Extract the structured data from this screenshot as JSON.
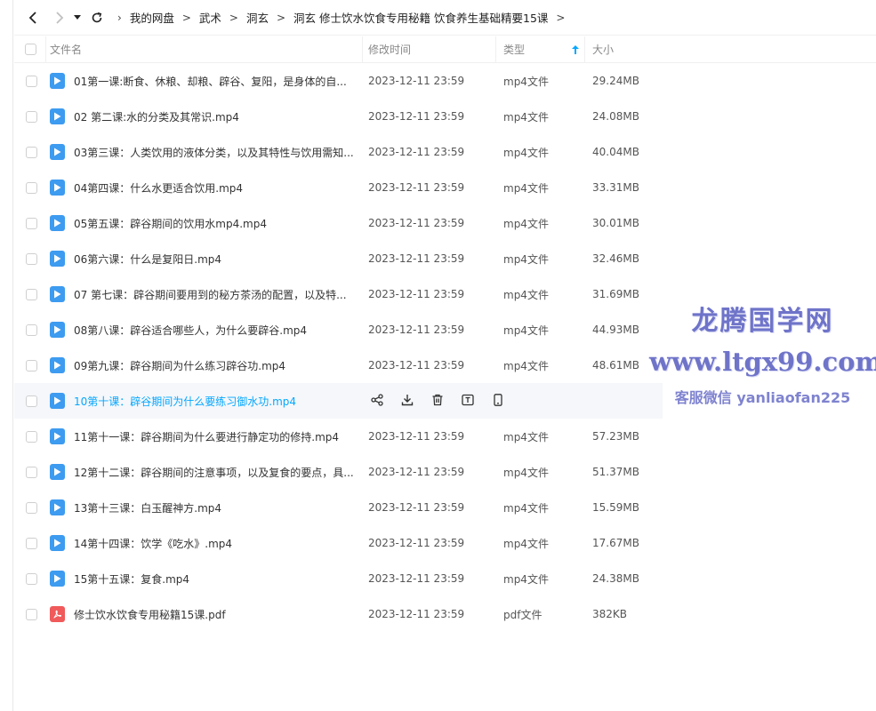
{
  "toolbar": {
    "breadcrumbs": [
      "我的网盘",
      "武术",
      "洞玄",
      "洞玄 修士饮水饮食专用秘籍 饮食养生基础精要15课"
    ]
  },
  "columns": {
    "name": "文件名",
    "time": "修改时间",
    "type": "类型",
    "size": "大小"
  },
  "files": [
    {
      "name": "01第一课:断食、休粮、却粮、辟谷、复阳，是身体的自...",
      "time": "2023-12-11 23:59",
      "type": "mp4文件",
      "size": "29.24MB",
      "kind": "mp4"
    },
    {
      "name": "02 第二课:水的分类及其常识.mp4",
      "time": "2023-12-11 23:59",
      "type": "mp4文件",
      "size": "24.08MB",
      "kind": "mp4"
    },
    {
      "name": "03第三课：人类饮用的液体分类，以及其特性与饮用需知...",
      "time": "2023-12-11 23:59",
      "type": "mp4文件",
      "size": "40.04MB",
      "kind": "mp4"
    },
    {
      "name": "04第四课：什么水更适合饮用.mp4",
      "time": "2023-12-11 23:59",
      "type": "mp4文件",
      "size": "33.31MB",
      "kind": "mp4"
    },
    {
      "name": "05第五课：辟谷期间的饮用水mp4.mp4",
      "time": "2023-12-11 23:59",
      "type": "mp4文件",
      "size": "30.01MB",
      "kind": "mp4"
    },
    {
      "name": "06第六课：什么是复阳日.mp4",
      "time": "2023-12-11 23:59",
      "type": "mp4文件",
      "size": "32.46MB",
      "kind": "mp4"
    },
    {
      "name": "07 第七课：辟谷期间要用到的秘方茶汤的配置，以及特...",
      "time": "2023-12-11 23:59",
      "type": "mp4文件",
      "size": "31.69MB",
      "kind": "mp4"
    },
    {
      "name": "08第八课：辟谷适合哪些人，为什么要辟谷.mp4",
      "time": "2023-12-11 23:59",
      "type": "mp4文件",
      "size": "44.93MB",
      "kind": "mp4"
    },
    {
      "name": "09第九课：辟谷期间为什么练习辟谷功.mp4",
      "time": "2023-12-11 23:59",
      "type": "mp4文件",
      "size": "48.61MB",
      "kind": "mp4"
    },
    {
      "name": "10第十课：辟谷期间为什么要练习御水功.mp4",
      "time": "",
      "type": "",
      "size": "",
      "kind": "mp4"
    },
    {
      "name": "11第十一课：辟谷期间为什么要进行静定功的修持.mp4",
      "time": "2023-12-11 23:59",
      "type": "mp4文件",
      "size": "57.23MB",
      "kind": "mp4"
    },
    {
      "name": "12第十二课：辟谷期间的注意事项，以及复食的要点，具...",
      "time": "2023-12-11 23:59",
      "type": "mp4文件",
      "size": "51.37MB",
      "kind": "mp4"
    },
    {
      "name": "13第十三课：白玉醒神方.mp4",
      "time": "2023-12-11 23:59",
      "type": "mp4文件",
      "size": "15.59MB",
      "kind": "mp4"
    },
    {
      "name": "14第十四课：饮学《吃水》.mp4",
      "time": "2023-12-11 23:59",
      "type": "mp4文件",
      "size": "17.67MB",
      "kind": "mp4"
    },
    {
      "name": "15第十五课：复食.mp4",
      "time": "2023-12-11 23:59",
      "type": "mp4文件",
      "size": "24.38MB",
      "kind": "mp4"
    },
    {
      "name": "修士饮水饮食专用秘籍15课.pdf",
      "time": "2023-12-11 23:59",
      "type": "pdf文件",
      "size": "382KB",
      "kind": "pdf"
    }
  ],
  "hover_row_index": 9,
  "hover_actions": [
    "share-icon",
    "download-icon",
    "delete-icon",
    "rename-icon",
    "mobile-icon"
  ],
  "watermark": {
    "line1": "龙腾国学网",
    "line2": "www.ltgx99.com",
    "line3": "客服微信 yanliaofan225"
  },
  "colors": {
    "accent": "#06a7ff",
    "mp4_icon": "#3d9bf0",
    "pdf_icon": "#f05a5a",
    "watermark": "#6f74c9"
  }
}
